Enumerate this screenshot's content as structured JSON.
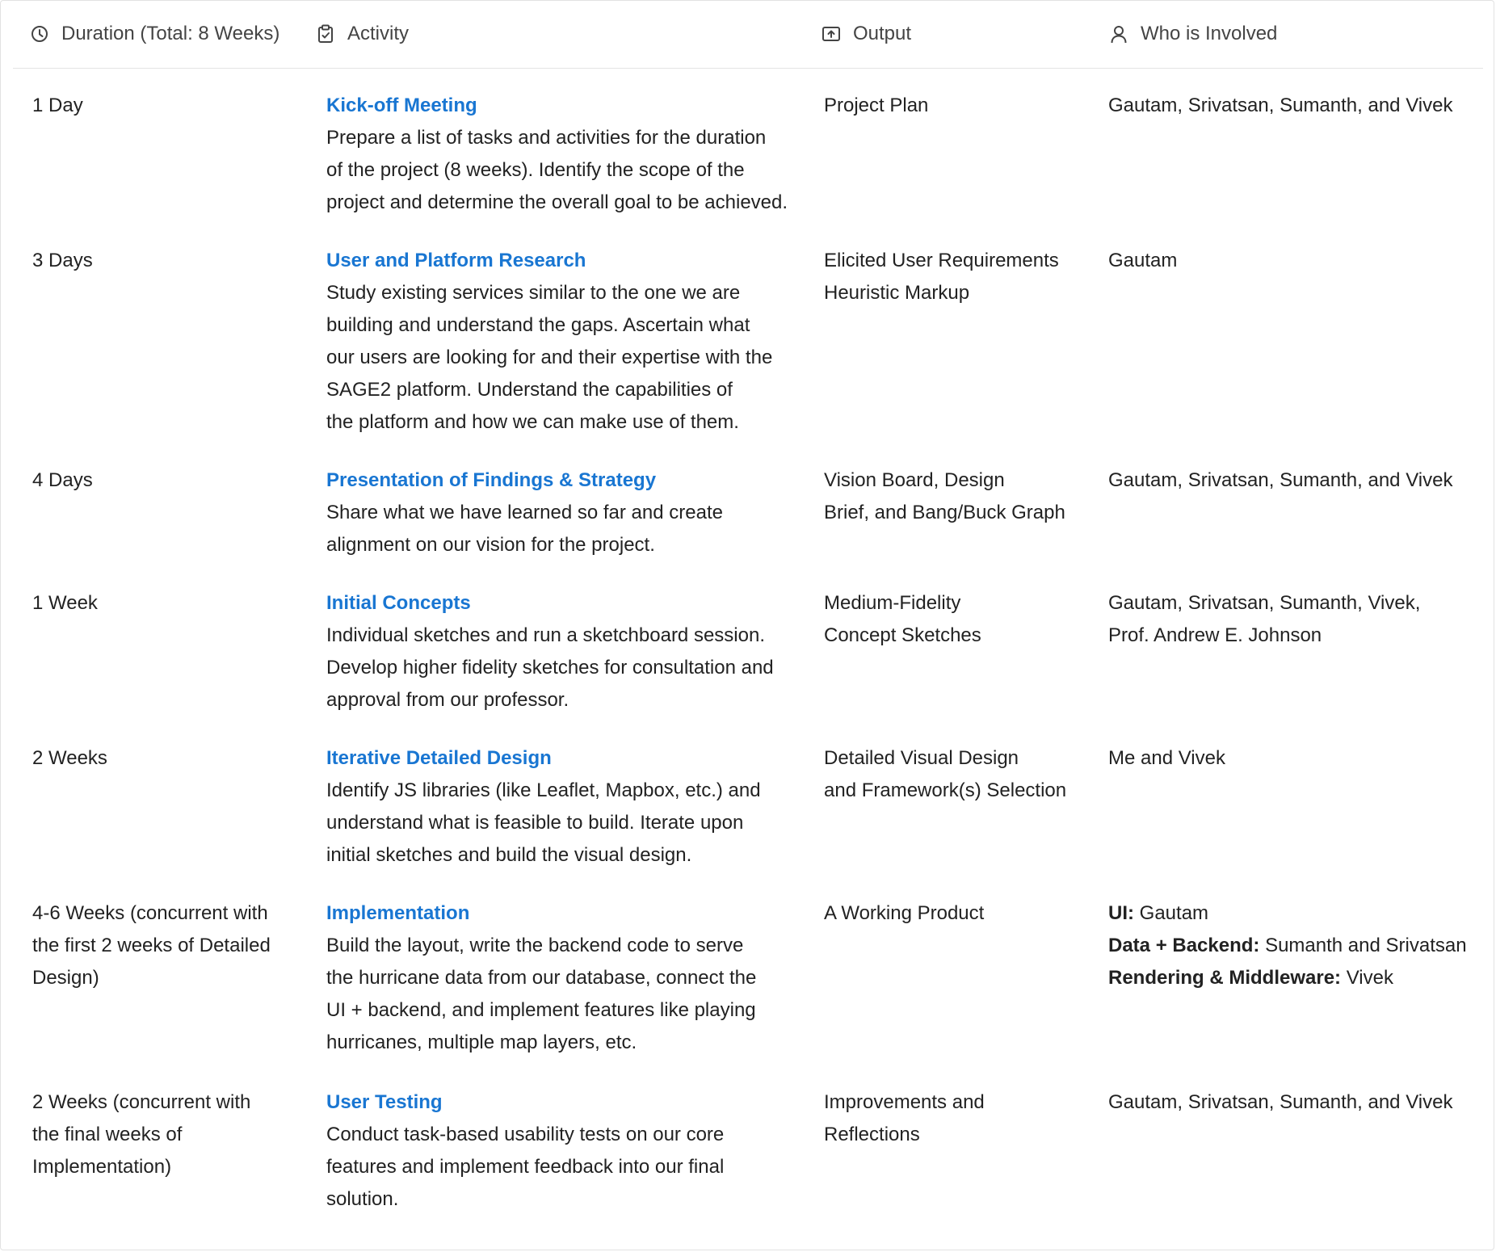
{
  "header": {
    "duration": "Duration (Total: 8 Weeks)",
    "activity": "Activity",
    "output": "Output",
    "who": "Who is Involved"
  },
  "icons": {
    "duration": "clock-icon",
    "activity": "clipboard-check-icon",
    "output": "upload-box-icon",
    "who": "person-icon"
  },
  "accent_color": "#1976d2",
  "rows": [
    {
      "duration": [
        "1 Day"
      ],
      "title": "Kick-off Meeting",
      "desc": [
        "Prepare a list of tasks and activities for the duration",
        "of the project (8 weeks). Identify the scope of the",
        "project and determine the overall goal to be achieved."
      ],
      "output": [
        "Project Plan"
      ],
      "who": [
        "Gautam, Srivatsan, Sumanth, and Vivek"
      ]
    },
    {
      "duration": [
        "3 Days"
      ],
      "title": "User and Platform Research",
      "desc": [
        "Study existing services similar to the one we are",
        "building and understand the gaps. Ascertain what",
        "our users are looking for and their expertise with the",
        "SAGE2 platform. Understand the capabilities of",
        "the platform and how we can make use of them."
      ],
      "output": [
        "Elicited User Requirements",
        "Heuristic Markup"
      ],
      "who": [
        "Gautam"
      ]
    },
    {
      "duration": [
        "4 Days"
      ],
      "title": "Presentation of Findings & Strategy",
      "desc": [
        "Share what we have learned so far and create",
        "alignment on our vision for the project."
      ],
      "output": [
        "Vision Board, Design",
        "Brief, and Bang/Buck Graph"
      ],
      "who": [
        "Gautam, Srivatsan, Sumanth, and Vivek"
      ]
    },
    {
      "duration": [
        "1 Week"
      ],
      "title": "Initial Concepts",
      "desc": [
        "Individual sketches and run a sketchboard session.",
        "Develop higher fidelity sketches for consultation and",
        "approval from our professor."
      ],
      "output": [
        "Medium-Fidelity",
        "Concept Sketches"
      ],
      "who": [
        "Gautam, Srivatsan, Sumanth, Vivek,",
        "Prof. Andrew E. Johnson"
      ]
    },
    {
      "duration": [
        "2 Weeks"
      ],
      "title": "Iterative Detailed Design",
      "desc": [
        "Identify JS libraries (like Leaflet, Mapbox, etc.) and",
        "understand what is feasible to build. Iterate upon",
        "initial sketches and build the visual design."
      ],
      "output": [
        "Detailed Visual Design",
        "and Framework(s) Selection"
      ],
      "who": [
        "Me and Vivek"
      ]
    },
    {
      "duration": [
        "4-6 Weeks (concurrent with",
        "the first 2 weeks of Detailed",
        "Design)"
      ],
      "title": "Implementation",
      "desc": [
        "Build the layout, write the backend code to serve",
        "the hurricane data from our database, connect the",
        "UI + backend, and implement features like playing",
        "hurricanes, multiple map layers, etc."
      ],
      "output": [
        "A Working Product"
      ],
      "who_labeled": [
        {
          "label": "UI:",
          "value": " Gautam"
        },
        {
          "label": "Data + Backend:",
          "value": " Sumanth and Srivatsan"
        },
        {
          "label": "Rendering & Middleware:",
          "value": " Vivek"
        }
      ]
    },
    {
      "duration": [
        "2 Weeks (concurrent with",
        "the final weeks of",
        "Implementation)"
      ],
      "title": "User Testing",
      "desc": [
        "Conduct task-based usability tests on our core",
        "features and implement feedback into our final",
        "solution."
      ],
      "output": [
        "Improvements and",
        "Reflections"
      ],
      "who": [
        "Gautam, Srivatsan, Sumanth, and Vivek"
      ]
    }
  ]
}
